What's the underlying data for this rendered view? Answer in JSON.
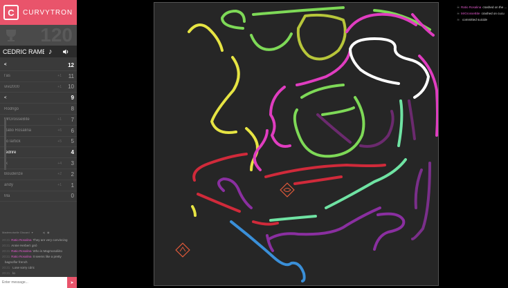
{
  "brand": {
    "logo_letter": "C",
    "name": "CURVYTRON",
    "color": "#e9546b"
  },
  "score_panel": {
    "top_score": "120",
    "trophy_icon": "trophy-icon"
  },
  "player": {
    "name": "CEDRIC RAME",
    "music_icon": "music-note-icon",
    "sound_icon": "speaker-icon"
  },
  "scoreboard": [
    {
      "name": "<",
      "delta": "",
      "score": "12",
      "color": "#ffffff",
      "style": "me"
    },
    {
      "name": "l'as",
      "delta": "+1",
      "score": "11",
      "color": "#8a8a8a",
      "style": ""
    },
    {
      "name": "vivi2000",
      "delta": "+1",
      "score": "10",
      "color": "#8a8a8a",
      "style": ""
    },
    {
      "name": "<",
      "delta": "",
      "score": "9",
      "color": "#ffffff",
      "style": "bold"
    },
    {
      "name": "Rodrigo",
      "delta": "",
      "score": "8",
      "color": "#8a8a8a",
      "style": ""
    },
    {
      "name": "MrGrosseBite",
      "delta": "+1",
      "score": "7",
      "color": "#8a8a8a",
      "style": ""
    },
    {
      "name": "Ratio Rosalina",
      "delta": "+6",
      "score": "6",
      "color": "#8a8a8a",
      "style": ""
    },
    {
      "name": "Jo lartick",
      "delta": "+5",
      "score": "5",
      "color": "#8a8a8a",
      "style": ""
    },
    {
      "name": "redrire",
      "delta": "",
      "score": "4",
      "color": "#ffffff",
      "style": "bold"
    },
    {
      "name": "rk",
      "delta": "+4",
      "score": "3",
      "color": "#8a8a8a",
      "style": ""
    },
    {
      "name": "Bouderize",
      "delta": "+2",
      "score": "2",
      "color": "#8a8a8a",
      "style": ""
    },
    {
      "name": "andy",
      "delta": "+1",
      "score": "1",
      "color": "#8a8a8a",
      "style": ""
    },
    {
      "name": "Ma",
      "delta": "",
      "score": "0",
      "color": "#8a8a8a",
      "style": ""
    }
  ],
  "chat": {
    "header": "Mademoiselle Giscard",
    "messages": [
      {
        "time": "20:21",
        "user": "Ratio Rosalina",
        "user_color": "#e05acb",
        "text": "They are very convincing"
      },
      {
        "time": "20:21",
        "user": "Annie Herbert",
        "user_color": "#aaaaaa",
        "text": "gnô"
      },
      {
        "time": "20:21",
        "user": "Ratio Rosalina",
        "user_color": "#e05acb",
        "text": "Who is Magmosoliiito"
      },
      {
        "time": "20:21",
        "user": "Ratio Rosalina",
        "user_color": "#e05acb",
        "text": "It seems like a pretty"
      },
      {
        "time": "",
        "user": "",
        "user_color": "#aaaaaa",
        "text": "bagnoflor french"
      },
      {
        "time": "20:21",
        "user": "",
        "user_color": "#aaaaaa",
        "text": "Lose sorry cdric"
      },
      {
        "time": "20:21",
        "user": "",
        "user_color": "#aaaaaa",
        "text": "lo"
      }
    ],
    "input_placeholder": "Enter message...",
    "send_icon": "send-icon"
  },
  "feed": [
    {
      "icon": "skull-icon",
      "player": "Ratio Rosalina",
      "player_color": "#e05acb",
      "text": "crashed on the ..."
    },
    {
      "icon": "skull-icon",
      "player": "MrGrosseBite",
      "player_color": "#e05acb",
      "text": "crashed on cucu"
    },
    {
      "icon": "skull-icon",
      "player": "",
      "player_color": "#e05acb",
      "text": "committed suicide"
    }
  ],
  "colors": {
    "arena_bg": "#262626",
    "yellow": "#e6e443",
    "green": "#7ed957",
    "olive": "#b7c63a",
    "magenta": "#e03dc0",
    "white": "#ffffff",
    "mint": "#6fe3a3",
    "purple": "#7a2f8a",
    "violet": "#6b2a6e",
    "red": "#d02a3a",
    "blue": "#3a8fd8",
    "bonus": "#e05a3a"
  }
}
